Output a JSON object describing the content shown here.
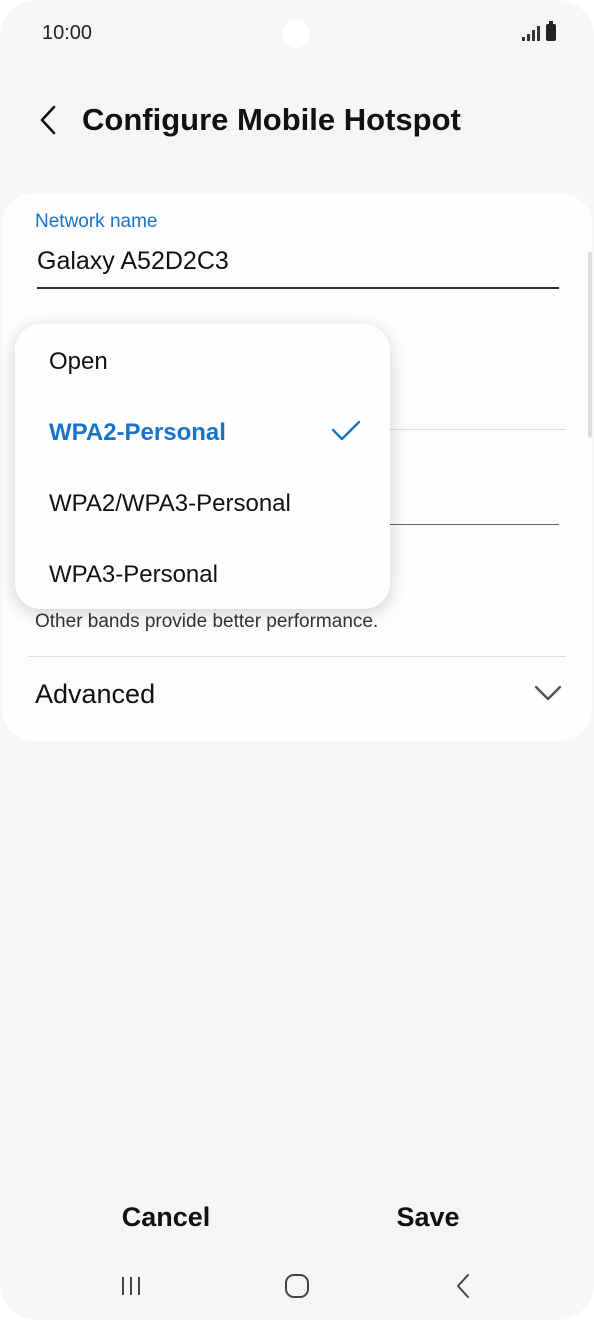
{
  "status_bar": {
    "time": "10:00"
  },
  "header": {
    "title": "Configure Mobile Hotspot"
  },
  "network": {
    "label": "Network name",
    "value": "Galaxy A52D2C3"
  },
  "security_menu": {
    "options": [
      "Open",
      "WPA2-Personal",
      "WPA2/WPA3-Personal",
      "WPA3-Personal"
    ],
    "selected": "WPA2-Personal"
  },
  "band": {
    "description": "Other bands provide better performance."
  },
  "advanced": {
    "label": "Advanced"
  },
  "actions": {
    "cancel": "Cancel",
    "save": "Save"
  },
  "colors": {
    "accent": "#1a73c9",
    "background": "#f6f6f6",
    "card": "#fdfdfd"
  }
}
